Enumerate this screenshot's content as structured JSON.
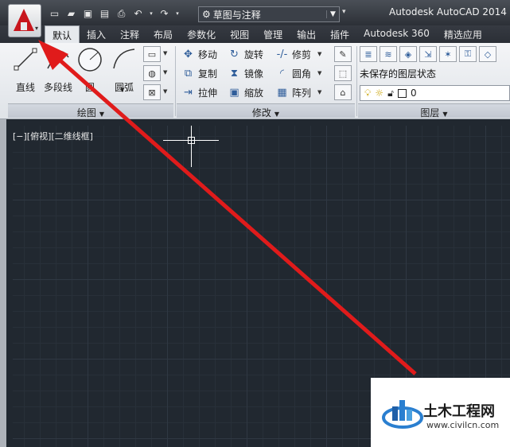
{
  "app": {
    "title": "Autodesk AutoCAD 2014",
    "workspace": "草图与注释"
  },
  "tabs": [
    "默认",
    "插入",
    "注释",
    "布局",
    "参数化",
    "视图",
    "管理",
    "输出",
    "插件",
    "Autodesk 360",
    "精选应用"
  ],
  "draw_panel": {
    "title": "绘图",
    "tools": {
      "line": "直线",
      "polyline": "多段线",
      "circle": "圆",
      "arc": "圆弧"
    }
  },
  "modify_panel": {
    "title": "修改",
    "items": {
      "move": "移动",
      "rotate": "旋转",
      "trim": "修剪",
      "copy": "复制",
      "mirror": "镜像",
      "fillet": "圆角",
      "stretch": "拉伸",
      "scale": "缩放",
      "array": "阵列"
    }
  },
  "layer_panel": {
    "title": "图层",
    "state": "未保存的图层状态",
    "current_layer": "0"
  },
  "viewport": {
    "label": "[−][俯视][二维线框]"
  },
  "overlay": {
    "arrow_color": "#e01b1b"
  },
  "watermark": {
    "name": "土木工程网",
    "url": "www.civilcn.com"
  }
}
